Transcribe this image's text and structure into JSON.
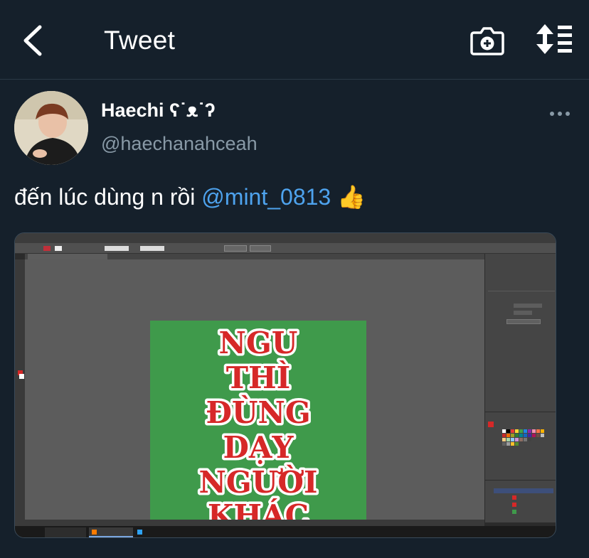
{
  "header": {
    "title": "Tweet",
    "icons": [
      "back-arrow-icon",
      "camera-add-icon",
      "sort-icon"
    ]
  },
  "tweet": {
    "display_name": "Haechi ʕ˙ᴥ˙ʔ",
    "handle": "@haechanahceah",
    "text_prefix": "đến lúc dùng n rồi ",
    "mention": "@mint_0813",
    "emoji": "👍",
    "more_icon": "more-dots-icon"
  },
  "media": {
    "artwork_lines": [
      "NGU",
      "THÌ",
      "ĐÙNG",
      "DẠY",
      "NGƯỜI",
      "KHÁC"
    ],
    "colors": {
      "artboard_bg": "#3f9a4b",
      "text_fill": "#d62828",
      "text_stroke": "#ffffff"
    }
  },
  "colors": {
    "background": "#15202b",
    "text": "#ffffff",
    "secondary_text": "#8899a6",
    "link": "#4ea3ee"
  }
}
